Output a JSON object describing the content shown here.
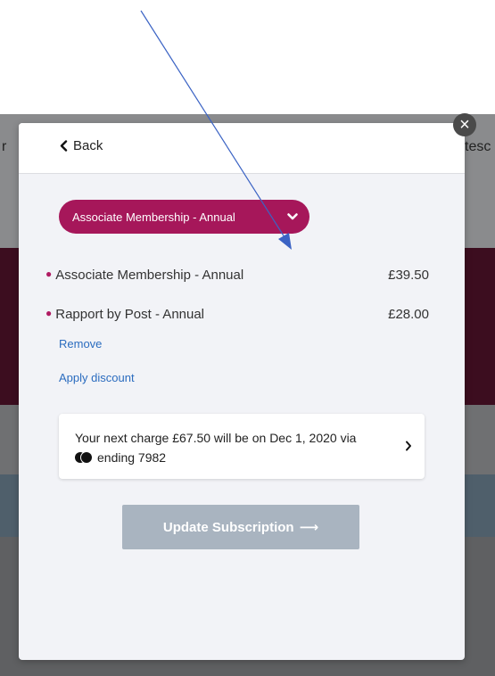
{
  "background": {
    "left_fragment": "r",
    "right_fragment": "tesc"
  },
  "modal": {
    "close_glyph": "×",
    "back_label": "Back",
    "plan_selector": {
      "label": "Associate Membership - Annual"
    },
    "items": [
      {
        "name": "Associate Membership - Annual",
        "price": "£39.50"
      },
      {
        "name": "Rapport by Post - Annual",
        "price": "£28.00"
      }
    ],
    "remove_label": "Remove",
    "apply_discount_label": "Apply discount",
    "charge": {
      "text": "Your next charge £67.50 will be on Dec 1, 2020 via",
      "card_text": "ending 7982"
    },
    "update_button_label": "Update Subscription",
    "update_button_arrow": "⟶"
  },
  "colors": {
    "accent": "#a6175a",
    "link": "#2b6cbf",
    "button_disabled": "#a9b4c0",
    "annotation_arrow": "#3b63c4"
  },
  "icons": {
    "back": "chevron-left-icon",
    "plan_dropdown": "chevron-down-icon",
    "card_brand": "mastercard-icon",
    "charge_details": "chevron-right-icon",
    "annotation": "arrow-annotation"
  }
}
